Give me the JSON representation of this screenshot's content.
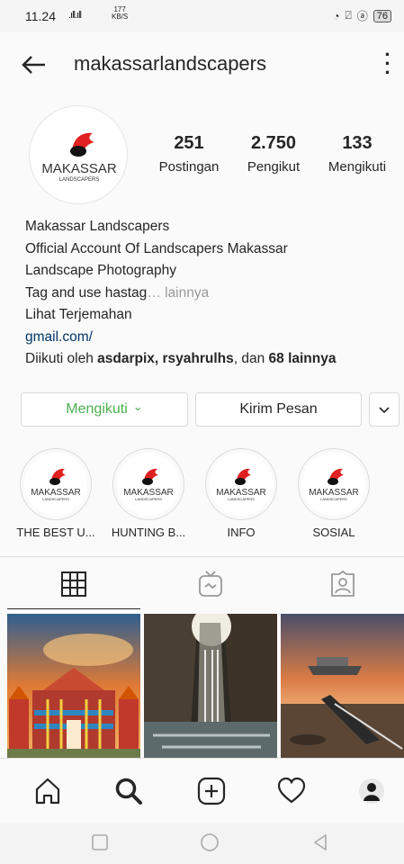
{
  "status_bar": {
    "time": "11.24",
    "signal": ".ıll.ıll",
    "net_speed_top": "177",
    "net_speed_unit": "KB/S",
    "battery": "76"
  },
  "header": {
    "username": "makassarlandscapers"
  },
  "profile": {
    "logo_text": "MAKASSAR",
    "logo_sub": "LANDSCAPERS"
  },
  "stats": [
    {
      "value": "251",
      "label": "Postingan"
    },
    {
      "value": "2.750",
      "label": "Pengikut"
    },
    {
      "value": "133",
      "label": "Mengikuti"
    }
  ],
  "bio": {
    "name": "Makassar Landscapers",
    "line1": "Official Account Of Landscapers Makassar",
    "line2": "Landscape Photography",
    "line3": "Tag and use hastag",
    "more": "… lainnya",
    "translate": "Lihat Terjemahan",
    "link": "gmail.com/",
    "followed_prefix": "Diikuti oleh ",
    "followed_users": "asdarpix, rsyahrulhs",
    "followed_mid": ", dan ",
    "followed_count": "68 lainnya"
  },
  "buttons": {
    "following": "Mengikuti",
    "following_caret": "⌄",
    "message": "Kirim Pesan",
    "dropdown": "⌄"
  },
  "highlights": [
    {
      "label": "THE BEST U..."
    },
    {
      "label": "HUNTING B..."
    },
    {
      "label": "INFO"
    },
    {
      "label": "SOSIAL"
    }
  ],
  "colors": {
    "following_green": "#4caf50",
    "link_blue": "#003569",
    "logo_red": "#e02020"
  }
}
